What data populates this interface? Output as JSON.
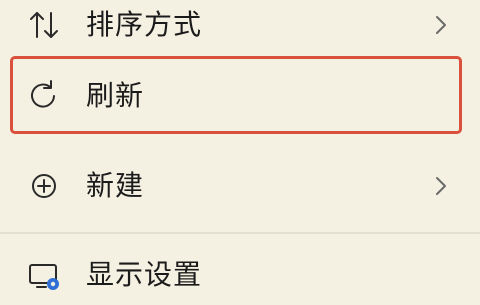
{
  "menu": {
    "items": [
      {
        "label": "排序方式",
        "icon": "sort-arrows-icon",
        "has_submenu": true
      },
      {
        "label": "刷新",
        "icon": "refresh-icon",
        "has_submenu": false,
        "highlighted": true
      },
      {
        "label": "新建",
        "icon": "new-plus-icon",
        "has_submenu": true
      },
      {
        "label": "显示设置",
        "icon": "display-settings-icon",
        "has_submenu": false
      }
    ]
  },
  "colors": {
    "background": "#f4f1e2",
    "highlight_border": "#d9503c",
    "text": "#1b1b1b",
    "icon": "#2a2a2a",
    "accent": "#2f6fd6"
  }
}
